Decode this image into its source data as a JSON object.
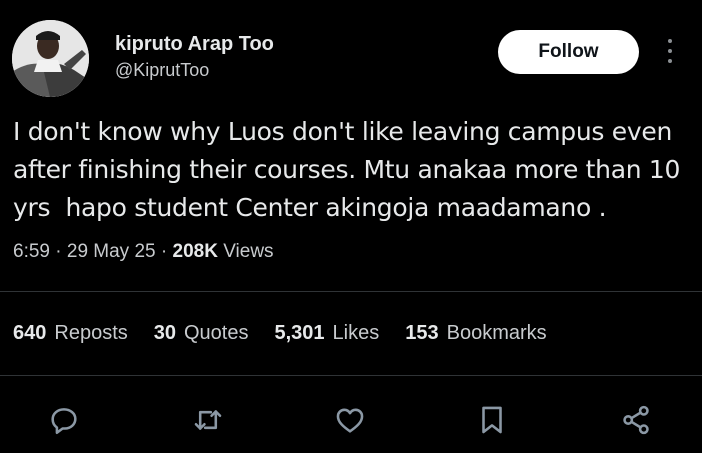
{
  "author": {
    "display_name": "kipruto Arap Too",
    "handle": "@KiprutToo",
    "avatar_icon": "person-avatar"
  },
  "follow_label": "Follow",
  "tweet": {
    "lines": [
      "I don't know why Luos don't like leaving campus even",
      "after finishing their courses. Mtu anakaa more than 10",
      "yrs  hapo student Center akingoja maadamano ."
    ]
  },
  "meta": {
    "time": "6:59",
    "date": "29 May 25",
    "views_count": "208K",
    "views_label": "Views",
    "separator": "·"
  },
  "stats": {
    "reposts": {
      "count": "640",
      "label": "Reposts"
    },
    "quotes": {
      "count": "30",
      "label": "Quotes"
    },
    "likes": {
      "count": "5,301",
      "label": "Likes"
    },
    "bookmarks": {
      "count": "153",
      "label": "Bookmarks"
    }
  },
  "actions": [
    "reply-icon",
    "repost-icon",
    "like-icon",
    "bookmark-icon",
    "share-icon"
  ],
  "colors": {
    "background": "#000000",
    "text": "#e7e9ea",
    "secondary_text": "#c8cbce",
    "icon": "#8b98a5",
    "divider": "#2f3336",
    "button_bg": "#ffffff"
  }
}
